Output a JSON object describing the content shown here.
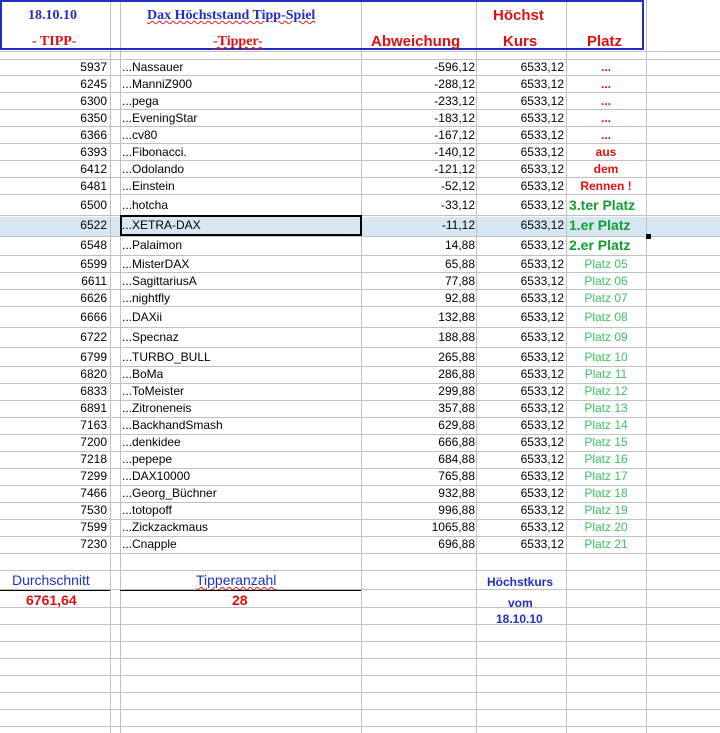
{
  "header": {
    "date": "18.10.10",
    "title": "Dax Höchststand Tipp-Spiel",
    "hoechst": "Höchst",
    "col_tipp": "- TIPP-",
    "col_tipper": "-Tipper-",
    "col_abweichung": "Abweichung",
    "col_kurs": "Kurs",
    "col_platz": "Platz"
  },
  "rows": [
    {
      "tipp": "5937",
      "name": "...Nassauer",
      "abw": "-596,12",
      "kurs": "6533,12",
      "platz": "..."
    },
    {
      "tipp": "6245",
      "name": "...ManniZ900",
      "abw": "-288,12",
      "kurs": "6533,12",
      "platz": "..."
    },
    {
      "tipp": "6300",
      "name": "...pega",
      "abw": "-233,12",
      "kurs": "6533,12",
      "platz": "..."
    },
    {
      "tipp": "6350",
      "name": "...EveningStar",
      "abw": "-183,12",
      "kurs": "6533,12",
      "platz": "..."
    },
    {
      "tipp": "6366",
      "name": "...cv80",
      "abw": "-167,12",
      "kurs": "6533,12",
      "platz": "..."
    },
    {
      "tipp": "6393",
      "name": "...Fibonacci.",
      "abw": "-140,12",
      "kurs": "6533,12",
      "platz": "aus"
    },
    {
      "tipp": "6412",
      "name": "...Odolando",
      "abw": "-121,12",
      "kurs": "6533,12",
      "platz": "dem"
    },
    {
      "tipp": "6481",
      "name": "...Einstein",
      "abw": "-52,12",
      "kurs": "6533,12",
      "platz": "Rennen !"
    },
    {
      "tipp": "6500",
      "name": "...hotcha",
      "abw": "-33,12",
      "kurs": "6533,12",
      "platz": "3.ter Platz"
    },
    {
      "tipp": "6522",
      "name": "...XETRA-DAX",
      "abw": "-11,12",
      "kurs": "6533,12",
      "platz": "1.er Platz"
    },
    {
      "tipp": "6548",
      "name": "...Palaimon",
      "abw": "14,88",
      "kurs": "6533,12",
      "platz": "2.er Platz"
    },
    {
      "tipp": "6599",
      "name": "...MisterDAX",
      "abw": "65,88",
      "kurs": "6533,12",
      "platz": "Platz 05"
    },
    {
      "tipp": "6611",
      "name": "...SagittariusA",
      "abw": "77,88",
      "kurs": "6533,12",
      "platz": "Platz 06"
    },
    {
      "tipp": "6626",
      "name": "...nightfly",
      "abw": "92,88",
      "kurs": "6533,12",
      "platz": "Platz 07"
    },
    {
      "tipp": "6666",
      "name": "...DAXii",
      "abw": "132,88",
      "kurs": "6533,12",
      "platz": "Platz 08"
    },
    {
      "tipp": "6722",
      "name": "...Specnaz",
      "abw": "188,88",
      "kurs": "6533,12",
      "platz": "Platz 09"
    },
    {
      "tipp": "6799",
      "name": "...TURBO_BULL",
      "abw": "265,88",
      "kurs": "6533,12",
      "platz": "Platz 10"
    },
    {
      "tipp": "6820",
      "name": "...BoMa",
      "abw": "286,88",
      "kurs": "6533,12",
      "platz": "Platz 11"
    },
    {
      "tipp": "6833",
      "name": "...ToMeister",
      "abw": "299,88",
      "kurs": "6533,12",
      "platz": "Platz 12"
    },
    {
      "tipp": "6891",
      "name": "...Zitroneneis",
      "abw": "357,88",
      "kurs": "6533,12",
      "platz": "Platz 13"
    },
    {
      "tipp": "7163",
      "name": "...BackhandSmash",
      "abw": "629,88",
      "kurs": "6533,12",
      "platz": "Platz 14"
    },
    {
      "tipp": "7200",
      "name": "...denkidee",
      "abw": "666,88",
      "kurs": "6533,12",
      "platz": "Platz 15"
    },
    {
      "tipp": "7218",
      "name": "...pepepe",
      "abw": "684,88",
      "kurs": "6533,12",
      "platz": "Platz 16"
    },
    {
      "tipp": "7299",
      "name": "...DAX10000",
      "abw": "765,88",
      "kurs": "6533,12",
      "platz": "Platz 17"
    },
    {
      "tipp": "7466",
      "name": "...Georg_Büchner",
      "abw": "932,88",
      "kurs": "6533,12",
      "platz": "Platz 18"
    },
    {
      "tipp": "7530",
      "name": "...totopoff",
      "abw": "996,88",
      "kurs": "6533,12",
      "platz": "Platz 19"
    },
    {
      "tipp": "7599",
      "name": "...Zickzackmaus",
      "abw": "1065,88",
      "kurs": "6533,12",
      "platz": "Platz 20"
    },
    {
      "tipp": "7230",
      "name": "...Cnapple",
      "abw": "696,88",
      "kurs": "6533,12",
      "platz": "Platz 21"
    }
  ],
  "summary": {
    "durchschnitt_label": "Durchschnitt",
    "durchschnitt_value": "6761,64",
    "tipperanzahl_label": "Tipperanzahl",
    "tipperanzahl_value": "28",
    "hoechstkurs_label": "Höchstkurs",
    "vom_label": "vom",
    "vom_date": "18.10.10"
  },
  "colors": {
    "header_border": "#1f2fbf",
    "red": "#e01010",
    "green_bold": "#10a030",
    "green_light": "#40c060",
    "blue_text": "#1f2fbf",
    "selection_bg": "#d6e6f3"
  }
}
